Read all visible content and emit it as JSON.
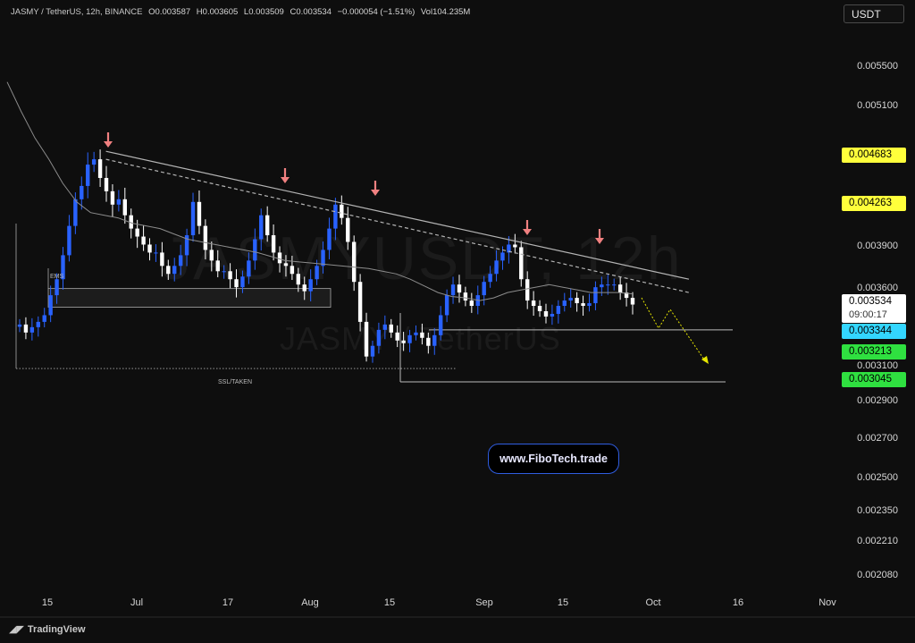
{
  "header": {
    "symbol": "JASMY / TetherUS, 12h, BINANCE",
    "open": "O0.003587",
    "high": "H0.003605",
    "low": "L0.003509",
    "close": "C0.003534",
    "change": "−0.000054 (−1.51%)",
    "volume": "Vol104.235M"
  },
  "currency_button": "USDT",
  "watermark": {
    "main": "JASMYUSDT, 12h",
    "sub": "JASMY / TetherUS"
  },
  "fibotech_label": "www.FiboTech.trade",
  "tradingview_label": "TradingView",
  "annotations": {
    "ems": "EMS",
    "ssl": "SSL/TAKEN"
  },
  "price_badges": [
    {
      "value": "0.004683",
      "bg": "#ffff3b",
      "fg": "#000000"
    },
    {
      "value": "0.004263",
      "bg": "#ffff3b",
      "fg": "#000000"
    },
    {
      "value": "0.003534",
      "bg": "#ffffff",
      "fg": "#000000",
      "sub": "09:00:17"
    },
    {
      "value": "0.003344",
      "bg": "#33d6ff",
      "fg": "#000000"
    },
    {
      "value": "0.003213",
      "bg": "#2fe040",
      "fg": "#000000"
    },
    {
      "value": "0.003045",
      "bg": "#2fe040",
      "fg": "#000000"
    }
  ],
  "colors": {
    "background": "#0e0e0e",
    "candle_up": "#2962ff",
    "candle_down": "#ffffff",
    "ma_line": "#8c8c8c",
    "trendline": "#b4b4b4",
    "arrow": "#f08080",
    "projection": "#e6e600"
  },
  "chart_data": {
    "type": "candlestick",
    "pair": "JASMY / TetherUS",
    "timeframe": "12h",
    "exchange": "BINANCE",
    "y_axis_labels": [
      "0.005500",
      "0.005100",
      "0.003900",
      "0.003600",
      "0.003100",
      "0.002900",
      "0.002700",
      "0.002500",
      "0.002350",
      "0.002210",
      "0.002080"
    ],
    "x_axis_labels": [
      "15",
      "Jul",
      "17",
      "Aug",
      "15",
      "Sep",
      "15",
      "Oct",
      "16",
      "Nov"
    ],
    "series_close": [
      0.00338,
      0.00332,
      0.00336,
      0.0034,
      0.00345,
      0.0036,
      0.00372,
      0.0039,
      0.00412,
      0.00432,
      0.00442,
      0.00458,
      0.00462,
      0.00448,
      0.00438,
      0.00428,
      0.00432,
      0.0042,
      0.0041,
      0.00404,
      0.00398,
      0.00392,
      0.00392,
      0.00382,
      0.00376,
      0.00382,
      0.0039,
      0.00405,
      0.0043,
      0.00412,
      0.00394,
      0.00386,
      0.00378,
      0.00378,
      0.00372,
      0.00366,
      0.00374,
      0.00386,
      0.00402,
      0.0042,
      0.00405,
      0.00392,
      0.00384,
      0.00382,
      0.00376,
      0.00368,
      0.00363,
      0.00372,
      0.00382,
      0.00394,
      0.0041,
      0.00428,
      0.00418,
      0.004,
      0.0037,
      0.0034,
      0.00314,
      0.00322,
      0.00334,
      0.00338,
      0.00332,
      0.00326,
      0.00324,
      0.0033,
      0.00332,
      0.00328,
      0.00322,
      0.0033,
      0.00345,
      0.0036,
      0.00368,
      0.00362,
      0.00356,
      0.00352,
      0.0036,
      0.0037,
      0.00376,
      0.00386,
      0.00392,
      0.00398,
      0.00396,
      0.00372,
      0.00356,
      0.00352,
      0.00348,
      0.00344,
      0.00346,
      0.00352,
      0.00356,
      0.00358,
      0.00354,
      0.00352,
      0.00354,
      0.00366,
      0.00368,
      0.00368,
      0.00368,
      0.00362,
      0.00358,
      0.00353
    ],
    "moving_average": [
      0.0052,
      0.00498,
      0.00478,
      0.00462,
      0.00444,
      0.0043,
      0.00422,
      0.0042,
      0.00418,
      0.00414,
      0.00412,
      0.0041,
      0.00406,
      0.00402,
      0.004,
      0.00398,
      0.00396,
      0.00394,
      0.00392,
      0.00389,
      0.00386,
      0.00385,
      0.00384,
      0.00383,
      0.00382,
      0.00381,
      0.0038,
      0.00378,
      0.00376,
      0.00372,
      0.00367,
      0.00362,
      0.00359,
      0.00358,
      0.00356,
      0.00358,
      0.00362,
      0.00364,
      0.00366,
      0.00368,
      0.00366,
      0.00364,
      0.00362,
      0.00362,
      0.00362,
      0.00361
    ],
    "trendlines": [
      {
        "style": "solid",
        "from": [
          0.117,
          0.00468
        ],
        "to": [
          0.82,
          0.00372
        ]
      },
      {
        "style": "dashed",
        "from": [
          0.117,
          0.00462
        ],
        "to": [
          0.82,
          0.00362
        ]
      }
    ],
    "levels": [
      {
        "name": "EMS zone",
        "top": 0.00365,
        "bottom": 0.00351
      },
      {
        "name": "SSL/TAKEN",
        "price": 0.00305
      },
      {
        "name": "support 1",
        "price": 0.00334
      },
      {
        "name": "support 2",
        "price": 0.00295
      }
    ],
    "signal_arrows": 5,
    "projection": "zigzag down"
  }
}
